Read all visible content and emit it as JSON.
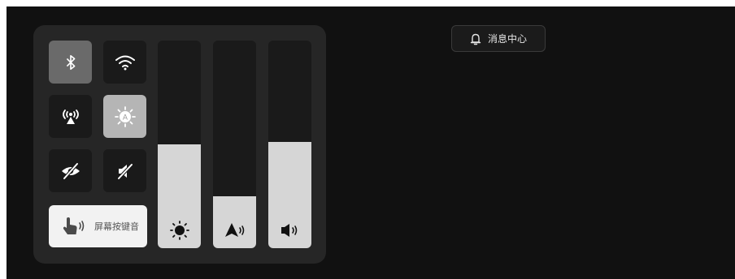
{
  "control_panel": {
    "toggles": [
      {
        "name": "bluetooth",
        "icon": "bluetooth-icon",
        "state": "on"
      },
      {
        "name": "wifi",
        "icon": "wifi-icon",
        "state": "off"
      },
      {
        "name": "hotspot",
        "icon": "hotspot-icon",
        "state": "off"
      },
      {
        "name": "auto-brightness",
        "icon": "auto-brightness-icon",
        "state": "on"
      },
      {
        "name": "privacy",
        "icon": "eye-off-icon",
        "state": "off"
      },
      {
        "name": "mute",
        "icon": "mute-icon",
        "state": "off"
      }
    ],
    "key_sound": {
      "label": "屏幕按键音",
      "icon": "touch-sound-icon",
      "state": "on"
    },
    "sliders": [
      {
        "name": "brightness",
        "icon": "brightness-icon",
        "level": 0.5
      },
      {
        "name": "navigation-volume",
        "icon": "navigation-volume-icon",
        "level": 0.25
      },
      {
        "name": "media-volume",
        "icon": "speaker-volume-icon",
        "level": 0.51
      }
    ]
  },
  "message_center": {
    "label": "消息中心",
    "icon": "bell-icon"
  },
  "colors": {
    "background": "#111111",
    "panel": "#262626",
    "tile_on": "#6a6a6a",
    "slider_fill": "#d6d6d6"
  }
}
